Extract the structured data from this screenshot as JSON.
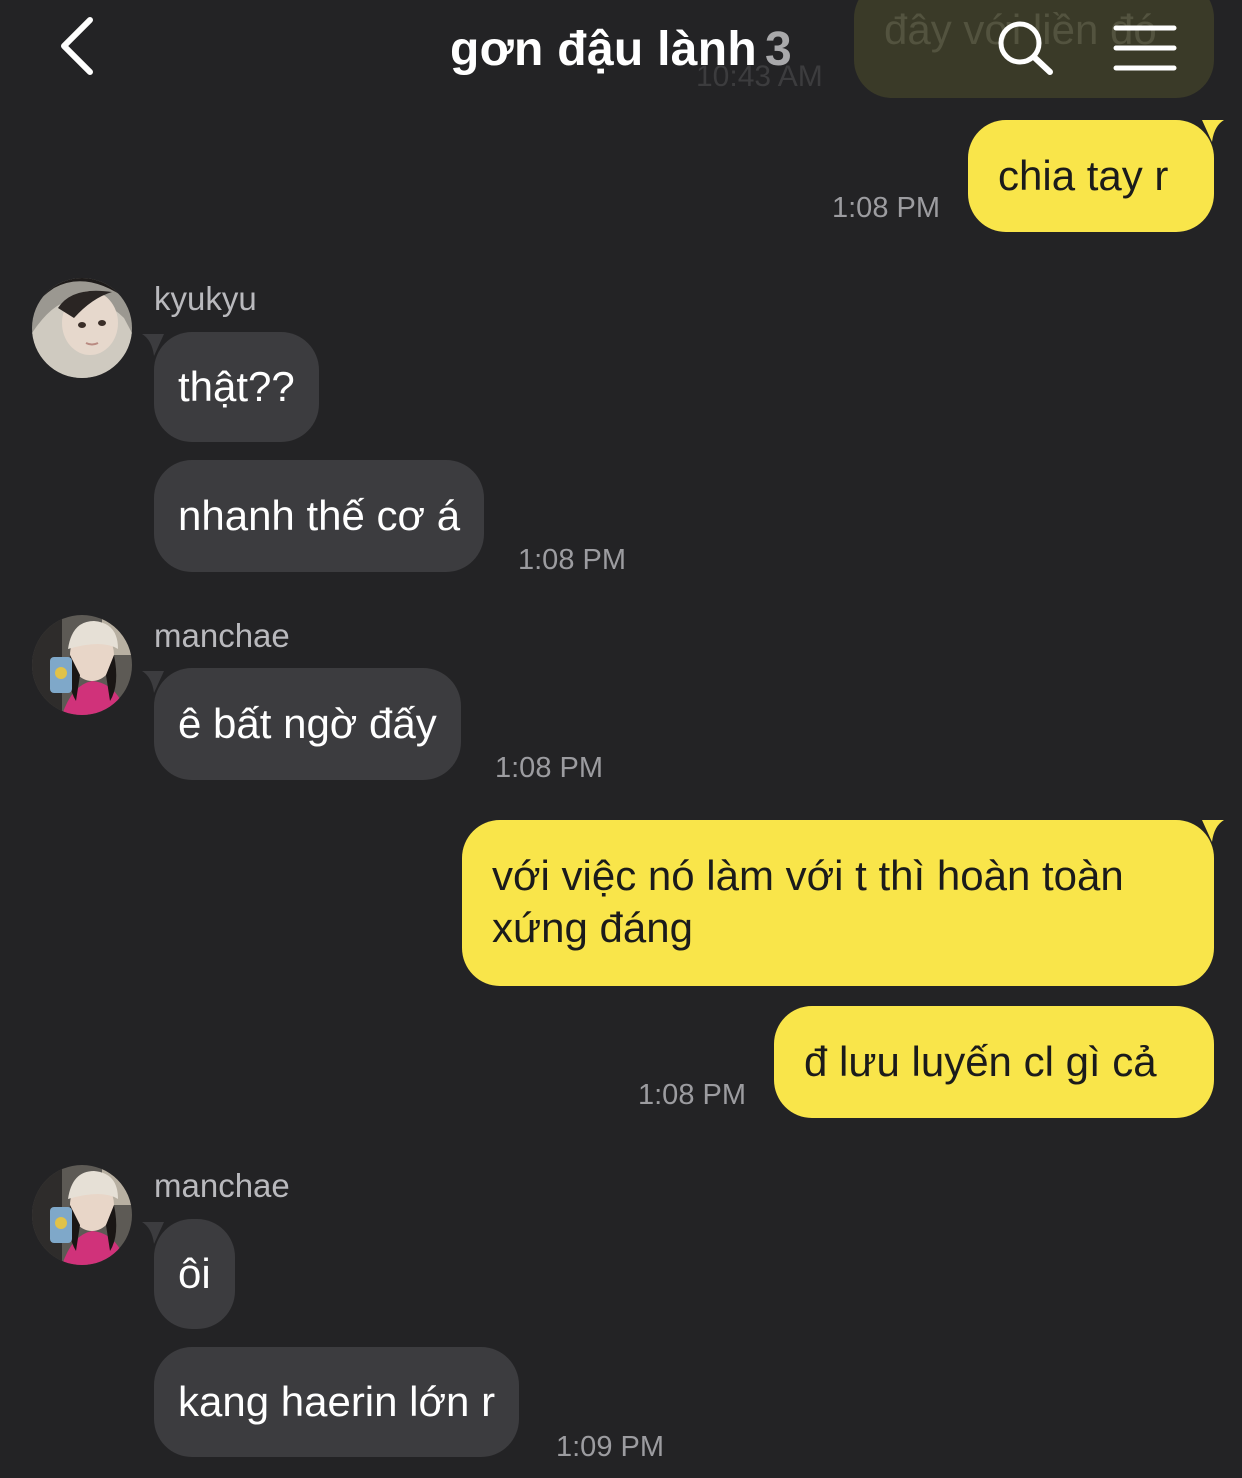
{
  "header": {
    "title": "gơn đậu lành",
    "member_count": "3",
    "back_icon": "chevron-left-icon",
    "search_icon": "search-icon",
    "menu_icon": "hamburger-menu-icon"
  },
  "colors": {
    "background": "#232325",
    "incoming_bubble": "#3c3c3f",
    "outgoing_bubble": "#f9e54a",
    "timestamp": "#9c9ca0"
  },
  "scrolled_partial": {
    "text": "đây với liền đó",
    "time": "10:43 AM"
  },
  "messages": {
    "m1": {
      "text": "chia tay r",
      "time": "1:08 PM"
    },
    "g1": {
      "sender": "kyukyu",
      "b1": "thật??",
      "b2": "nhanh thế cơ á",
      "time": "1:08 PM"
    },
    "g2": {
      "sender": "manchae",
      "b1": "ê bất ngờ đấy",
      "time": "1:08 PM"
    },
    "m2": {
      "line1": "với việc nó làm với t thì hoàn toàn",
      "line2": "xứng đáng"
    },
    "m3": {
      "text": "đ lưu luyến cl gì cả",
      "time": "1:08 PM"
    },
    "g3": {
      "sender": "manchae",
      "b1": "ôi",
      "b2": "kang haerin lớn r",
      "time": "1:09 PM"
    }
  }
}
